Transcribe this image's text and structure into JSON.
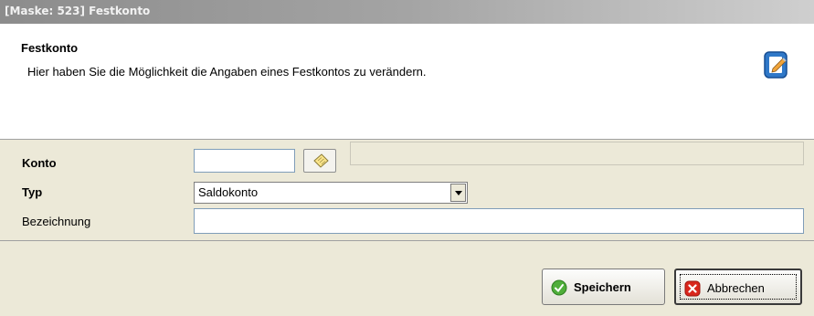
{
  "window": {
    "title": "[Maske: 523] Festkonto"
  },
  "header": {
    "title": "Festkonto",
    "description": "Hier haben Sie die Möglichkeit die Angaben eines Festkontos zu verändern."
  },
  "form": {
    "konto": {
      "label": "Konto",
      "value": "",
      "name_value": ""
    },
    "typ": {
      "label": "Typ",
      "selected": "Saldokonto"
    },
    "bezeichnung": {
      "label": "Bezeichnung",
      "value": ""
    }
  },
  "buttons": {
    "save": "Speichern",
    "cancel": "Abbrechen"
  },
  "colors": {
    "title_bar": "#8c8c8c",
    "dialog_bg": "#ece9d8",
    "save_icon": "#4fae3a",
    "cancel_icon": "#d9261c"
  }
}
